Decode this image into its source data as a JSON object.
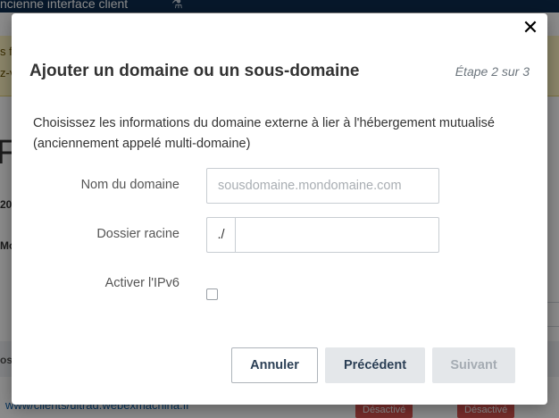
{
  "background": {
    "topbar_text": "ncienne interface client",
    "warning_line1": "s f",
    "warning_line2": "z-v",
    "big_text": "Fr",
    "small_text1": "20",
    "small_text2": "Mo",
    "row_head": "os",
    "row_link": "www/clients/ultrad.webexmachina.fr",
    "badge1": "Désactivé",
    "badge2": "Désactivé"
  },
  "modal": {
    "title": "Ajouter un domaine ou un sous-domaine",
    "step": "Étape 2 sur 3",
    "close_symbol": "✕",
    "intro": "Choisissez les informations du domaine externe à lier à l'hébergement mutualisé (anciennement appelé multi-domaine)",
    "form": {
      "domain_label": "Nom du domaine",
      "domain_placeholder": "sousdomaine.mondomaine.com",
      "domain_value": "",
      "root_label": "Dossier racine",
      "root_prefix": "./",
      "root_value": "",
      "ipv6_label": "Activer l'IPv6",
      "ipv6_checked": false
    },
    "buttons": {
      "cancel": "Annuler",
      "previous": "Précédent",
      "next": "Suivant"
    }
  }
}
